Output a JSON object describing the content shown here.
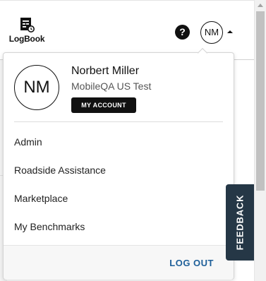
{
  "header": {
    "logbook_label": "LogBook",
    "help_glyph": "?",
    "avatar_initials": "NM",
    "icons": {
      "logbook": "logbook-icon",
      "help": "help-icon",
      "caret": "caret-up-icon"
    }
  },
  "profile_menu": {
    "avatar_initials": "NM",
    "user_name": "Norbert Miller",
    "organization": "MobileQA US Test",
    "my_account_label": "MY ACCOUNT",
    "items": [
      {
        "label": "Admin"
      },
      {
        "label": "Roadside Assistance"
      },
      {
        "label": "Marketplace"
      },
      {
        "label": "My Benchmarks"
      }
    ],
    "logout_label": "LOG OUT"
  },
  "feedback_tab": {
    "label": "FEEDBACK"
  },
  "colors": {
    "accent_link": "#1e5f99",
    "button_dark": "#111111",
    "feedback_bg": "#253746"
  }
}
